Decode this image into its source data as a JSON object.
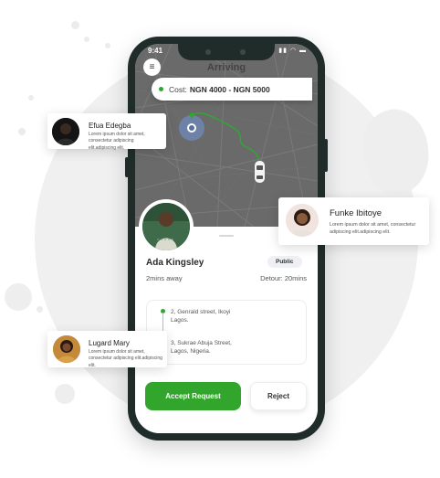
{
  "status": {
    "time": "9:41"
  },
  "map": {
    "title": "Arriving",
    "cost_label": "Cost:",
    "cost_value": "NGN 4000 - NGN 5000"
  },
  "driver": {
    "name": "Ada Kingsley",
    "eta": "2mins away",
    "badge": "Public",
    "detour": "Detour: 20mins"
  },
  "route": {
    "pickup": "2, Genrald street, Ikoyi\nLagos.",
    "dropoff": "3, Sukrae Abuja Street,\nLagos, Nigeria."
  },
  "actions": {
    "accept": "Accept Request",
    "reject": "Reject"
  },
  "cards": [
    {
      "name": "Efua Edegba",
      "desc": "Lorem ipsum dolor sit amet, consectetur adipiscing elit.adipiscing elit."
    },
    {
      "name": "Funke Ibitoye",
      "desc": "Lorem ipsum dolor sit amet, consectetur adipiscing elit.adipiscing elit."
    },
    {
      "name": "Lugard Mary",
      "desc": "Lorem ipsum dolor sit amet, consectetur adipiscing elit.adipiscing elit."
    }
  ],
  "colors": {
    "accent": "#31a52c",
    "phone": "#1f2c2a",
    "map": "#6a6a6a"
  }
}
